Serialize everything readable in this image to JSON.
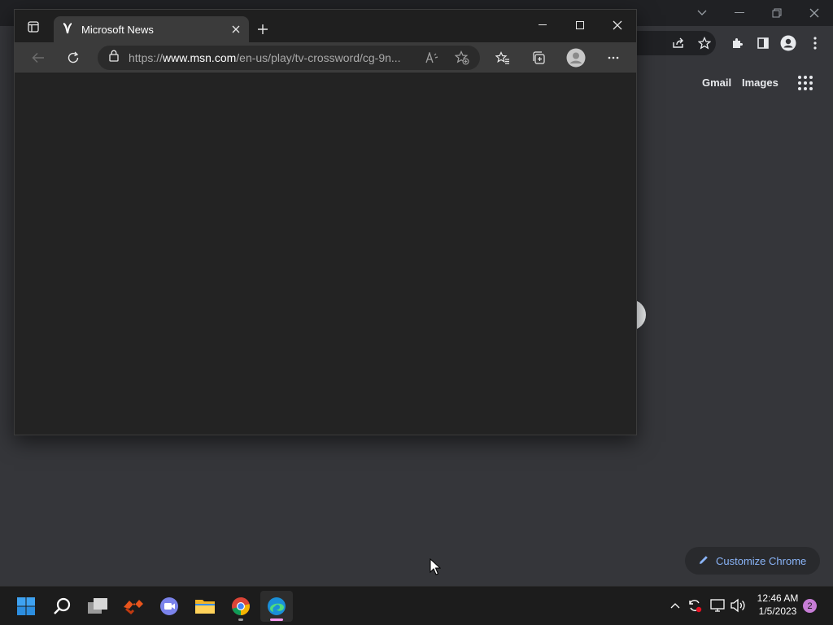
{
  "chrome_bg": {
    "links": {
      "gmail": "Gmail",
      "images": "Images"
    },
    "customize_label": "Customize Chrome"
  },
  "edge": {
    "tab_title": "Microsoft News",
    "url_prefix": "https://",
    "url_domain": "www.msn.com",
    "url_path": "/en-us/play/tv-crossword/cg-9n..."
  },
  "taskbar": {
    "apps": [
      "start-icon",
      "search-icon",
      "task-view-icon",
      "office-app-icon",
      "teams-chat-icon",
      "file-explorer-icon",
      "chrome-icon",
      "edge-icon"
    ],
    "active_app": "edge-icon",
    "time": "12:46 AM",
    "date": "1/5/2023",
    "notification_count": "2"
  },
  "colors": {
    "accent": "#8ab4f8",
    "edge_bg": "#202020",
    "taskbar_bg": "#1c1c1c",
    "notification_badge": "#c77dd6"
  }
}
